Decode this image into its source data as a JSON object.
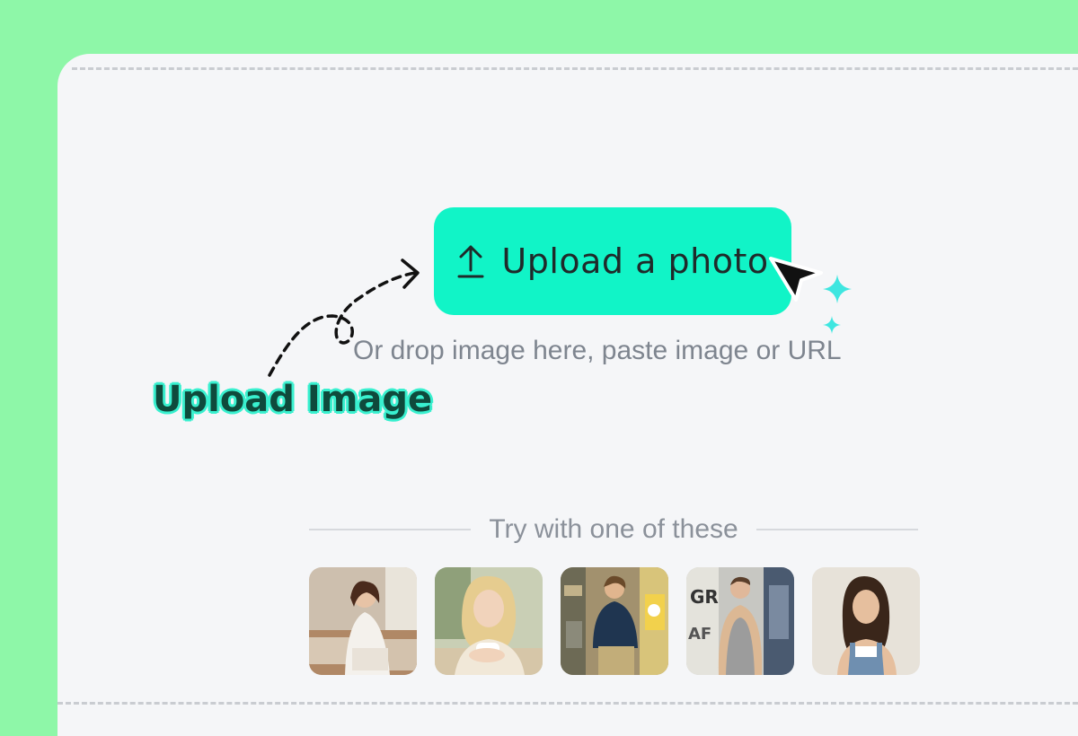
{
  "upload": {
    "button_label": "Upload a photo",
    "icon": "upload-arrow-icon",
    "hint": "Or drop image here, paste image or URL"
  },
  "callout": {
    "text": "Upload Image"
  },
  "samples": {
    "divider_text": "Try with one of these",
    "items": [
      {
        "name": "woman-on-sofa-photo"
      },
      {
        "name": "blonde-woman-coffee-photo"
      },
      {
        "name": "man-graffiti-hoodie-photo"
      },
      {
        "name": "man-graffiti-tanktop-photo"
      },
      {
        "name": "woman-overalls-photo"
      }
    ]
  },
  "colors": {
    "background": "#8ef7a8",
    "panel": "#f5f6f8",
    "accent": "#11f4c7",
    "callout_text": "#0f4a3c"
  }
}
